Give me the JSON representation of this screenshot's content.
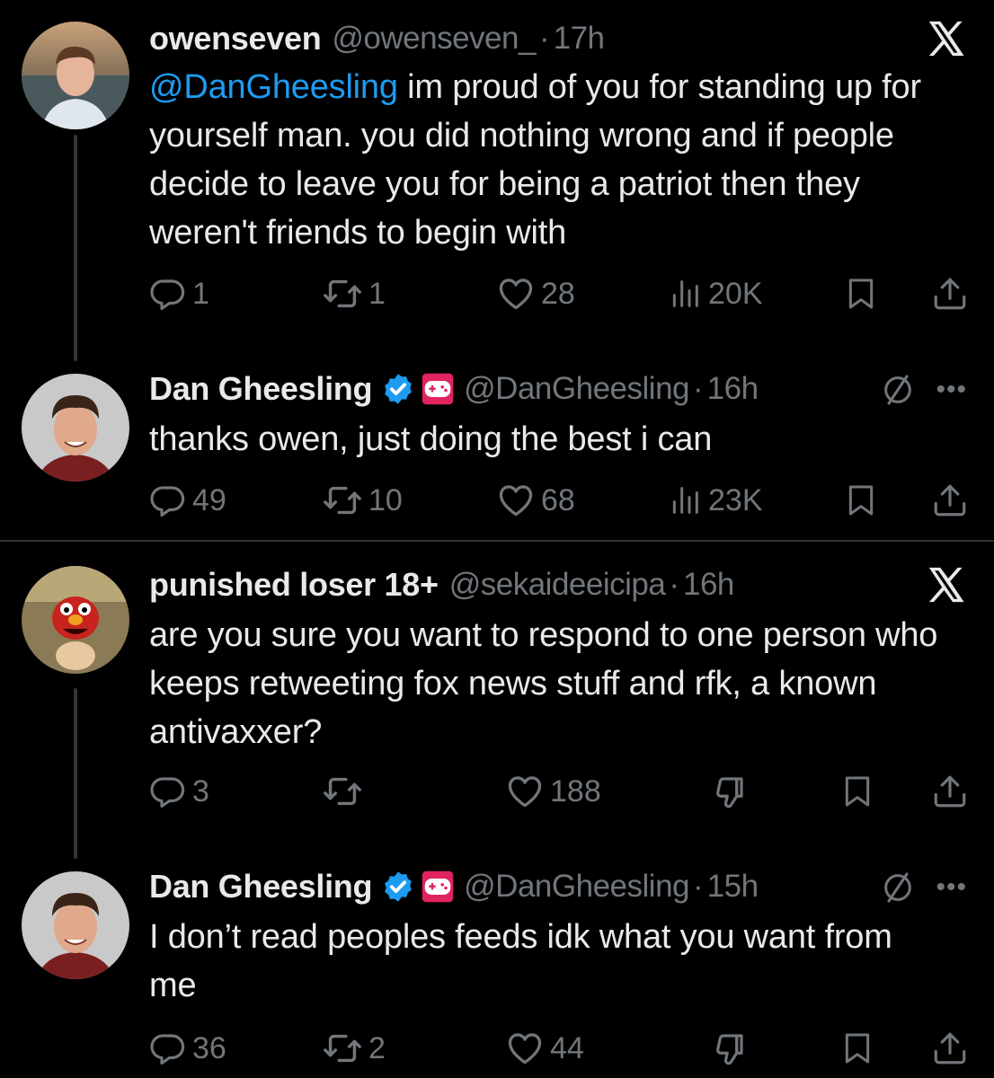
{
  "tweets": [
    {
      "name": "owenseven",
      "handle": "@owenseven_",
      "time": "17h",
      "mention": "@DanGheesling",
      "text": " im proud of you for standing up for yourself man. you did nothing wrong and if people decide to leave you for being a patriot then they weren't friends to begin with",
      "replies": "1",
      "retweets": "1",
      "likes": "28",
      "views": "20K",
      "verified": false
    },
    {
      "name": "Dan Gheesling",
      "handle": "@DanGheesling",
      "time": "16h",
      "text": "thanks owen, just doing the best i can",
      "replies": "49",
      "retweets": "10",
      "likes": "68",
      "views": "23K",
      "verified": true
    },
    {
      "name": "punished loser 18+",
      "handle": "@sekaideeicipa",
      "time": "16h",
      "text": "are you sure you want to respond to one person who keeps retweeting fox news stuff and rfk, a known antivaxxer?",
      "replies": "3",
      "retweets": "",
      "likes": "188",
      "verified": false
    },
    {
      "name": "Dan Gheesling",
      "handle": "@DanGheesling",
      "time": "15h",
      "text": "I don’t read peoples feeds idk what you want from me",
      "replies": "36",
      "retweets": "2",
      "likes": "44",
      "verified": true
    }
  ],
  "separator": "·",
  "icons": [
    "x-logo-icon",
    "verified-badge-icon",
    "game-controller-badge-icon",
    "mute-icon",
    "more-icon",
    "reply-icon",
    "retweet-icon",
    "like-icon",
    "views-icon",
    "downvote-icon",
    "bookmark-icon",
    "share-icon"
  ],
  "colors": {
    "background": "#000000",
    "text": "#e7e9ea",
    "muted": "#71767b",
    "link": "#1d9bf0",
    "verified": "#1d9bf0",
    "badge": "#e0245e"
  }
}
